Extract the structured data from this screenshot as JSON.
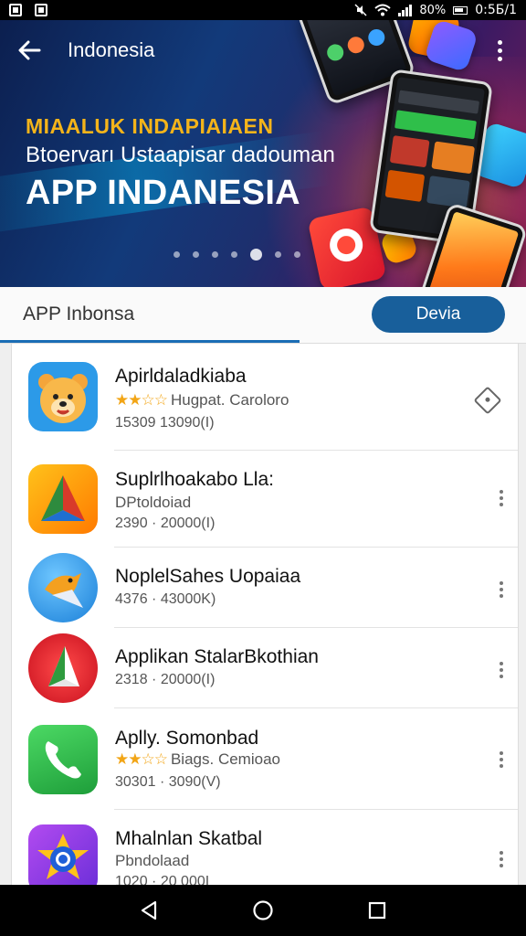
{
  "status_bar": {
    "battery_text": "80%",
    "time": "0:5Б/1",
    "icons": [
      "notification-icon",
      "notification-icon",
      "mute-icon",
      "wifi-icon",
      "signal-icon",
      "battery-icon"
    ]
  },
  "app_bar": {
    "title": "Indonesia",
    "back_icon": "arrow-left-icon",
    "more_icon": "overflow-menu-icon"
  },
  "banner": {
    "line1": "MIAALUK INDAPIAIAEN",
    "line2": "Btoervarı Ustaapisar dadouman",
    "line3": "APP INDANESIA",
    "carousel_page": 5,
    "carousel_total": 7,
    "colors": {
      "line1": "#f4b41a",
      "background": "#123a7a",
      "accent_glow": "#ff8c28"
    }
  },
  "tabs": {
    "active_label": "APP Inbonsa",
    "button_label": "Devia",
    "accent": "#1a6db5"
  },
  "apps": [
    {
      "name": "Apirldaladkiaba",
      "rating_stars": "★★☆☆",
      "sub": "Hugpat. Caroloro",
      "meta": "15309 13090(I)",
      "action": "diamond-icon",
      "icon": "bear-icon"
    },
    {
      "name": "Suplrlhoakabo Lla:",
      "sub": "DPtoldoiad",
      "meta": "2390 · 20000(I)",
      "action": "overflow-menu-icon",
      "icon": "triangle-logo-icon"
    },
    {
      "name": "NoplelSahes Uopaiaa",
      "sub": "",
      "meta": "4376 · 43000K)",
      "action": "overflow-menu-icon",
      "icon": "bird-logo-icon"
    },
    {
      "name": "Applikan StalarBkothian",
      "sub": "",
      "meta": "2318 · 20000(I)",
      "action": "overflow-menu-icon",
      "icon": "red-play-logo-icon"
    },
    {
      "name": "Aplly. Somonbad",
      "rating_stars": "★★☆☆",
      "sub": "Biags. Cemioao",
      "meta": "30301 · 3090(V)",
      "action": "overflow-menu-icon",
      "icon": "phone-icon"
    },
    {
      "name": "Mhalnlan Skatbal",
      "sub": "Pbndolaad",
      "meta": "1020 · 20 000I",
      "action": "overflow-menu-icon",
      "icon": "star-badge-icon"
    }
  ],
  "nav_bar": {
    "icons": [
      "back-triangle-icon",
      "home-circle-icon",
      "recents-square-icon"
    ]
  }
}
